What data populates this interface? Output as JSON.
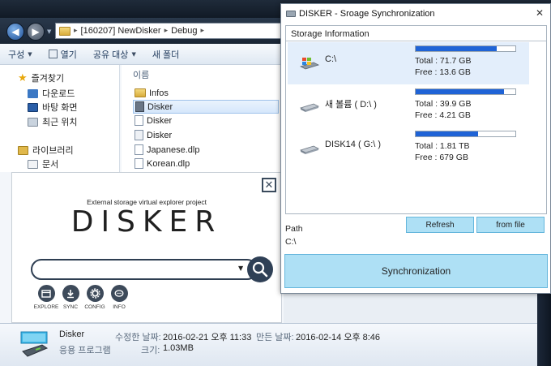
{
  "explorer": {
    "breadcrumb": [
      "[160207] NewDisker",
      "Debug"
    ],
    "toolbar": [
      {
        "label": "구성",
        "caret": true
      },
      {
        "label": "열기",
        "caret": false,
        "icon": "open-icon"
      },
      {
        "label": "공유 대상",
        "caret": true
      },
      {
        "label": "새 폴더",
        "caret": false
      }
    ],
    "nav": {
      "favorites": "즐겨찾기",
      "favorites_items": [
        "다운로드",
        "바탕 화면",
        "최근 위치"
      ],
      "libraries": "라이브러리",
      "libraries_items": [
        "문서"
      ]
    },
    "column_header": "이름",
    "files": [
      {
        "name": "Infos",
        "icon": "folder-icon",
        "selected": false
      },
      {
        "name": "Disker",
        "icon": "app-icon",
        "selected": true
      },
      {
        "name": "Disker",
        "icon": "file-icon",
        "selected": false
      },
      {
        "name": "Disker",
        "icon": "config-icon",
        "selected": false
      },
      {
        "name": "Japanese.dlp",
        "icon": "file-icon",
        "selected": false
      },
      {
        "name": "Korean.dlp",
        "icon": "file-icon",
        "selected": false
      }
    ],
    "details": {
      "name": "Disker",
      "type": "응용 프로그램",
      "modified_label": "수정한 날짜:",
      "modified_value": "2016-02-21 오후 11:33",
      "created_label": "만든 날짜:",
      "created_value": "2016-02-14 오후 8:46",
      "size_label": "크기:",
      "size_value": "1.03MB"
    }
  },
  "splash": {
    "tagline": "External storage virtual explorer project",
    "logo": "DISKER",
    "actions": [
      "EXPLORE",
      "SYNC",
      "CONFIG",
      "INFO"
    ]
  },
  "sync": {
    "title": "DISKER - Sroage Synchronization",
    "group_title": "Storage Information",
    "drives": [
      {
        "name": "C:\\",
        "total": "Total : 71.7 GB",
        "free": "Free : 13.6 GB",
        "used_fraction": 0.81,
        "selected": true
      },
      {
        "name": "새 볼륨 ( D:\\ )",
        "total": "Total : 39.9 GB",
        "free": "Free : 4.21 GB",
        "used_fraction": 0.89,
        "selected": false
      },
      {
        "name": "DISK14 ( G:\\ )",
        "total": "Total : 1.81 TB",
        "free": "Free : 679 GB",
        "used_fraction": 0.63,
        "selected": false
      }
    ],
    "refresh_label": "Refresh",
    "fromfile_label": "from file",
    "path_label": "Path",
    "path_value": "C:\\",
    "sync_label": "Synchronization",
    "accent": "#aee0f5",
    "bar_color": "#1f63d6"
  }
}
